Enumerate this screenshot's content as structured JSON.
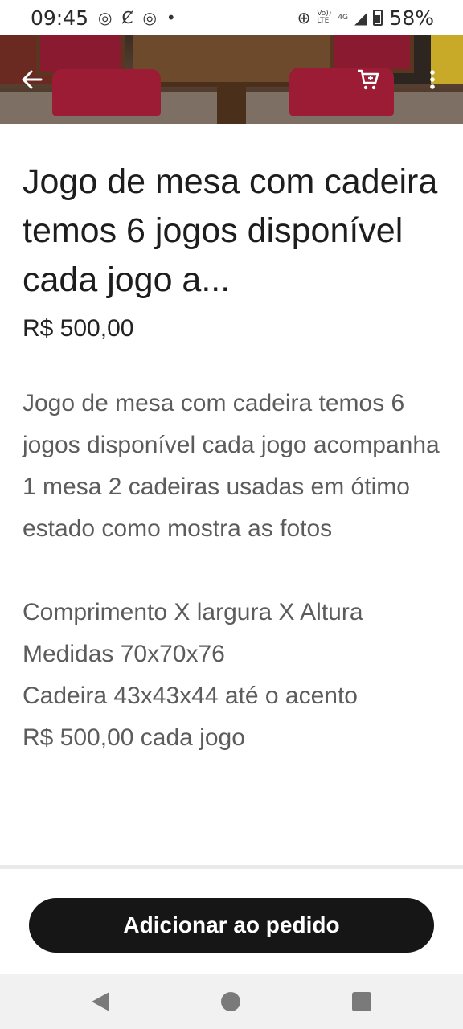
{
  "status_bar": {
    "time": "09:45",
    "network_top": "Vo))",
    "network_bottom": "LTE",
    "signal_label": "4G",
    "battery": "58%"
  },
  "header": {
    "back_icon": "arrow-left-icon",
    "cart_icon": "cart-icon",
    "more_icon": "more-vertical-icon"
  },
  "product": {
    "title": "Jogo de mesa com cadeira temos 6 jogos disponível cada jogo a...",
    "price": "R$ 500,00",
    "description": [
      "Jogo de mesa com cadeira temos 6 jogos disponível cada jogo acompanha 1 mesa 2 cadeiras usadas em ótimo estado como mostra as fotos",
      "",
      "Comprimento X largura X Altura",
      "Medidas 70x70x76",
      "Cadeira 43x43x44 até o acento",
      "R$ 500,00 cada jogo"
    ]
  },
  "footer": {
    "add_button_label": "Adicionar ao pedido"
  }
}
